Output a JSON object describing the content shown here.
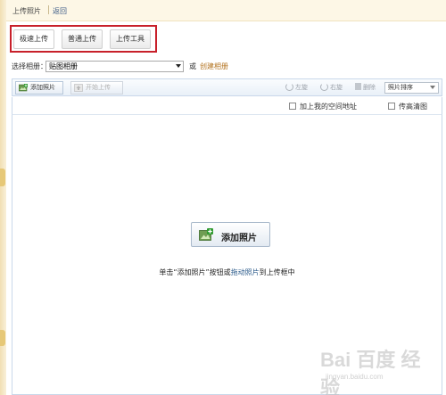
{
  "header": {
    "crumb": "上传照片",
    "back_label": "返回"
  },
  "tabs": [
    {
      "label": "极速上传",
      "active": true
    },
    {
      "label": "普通上传",
      "active": false
    },
    {
      "label": "上传工具",
      "active": false
    }
  ],
  "album": {
    "label": "选择相册：",
    "selected": "贴图相册",
    "or": "或",
    "create_label": "创建相册"
  },
  "toolbar": {
    "add_label": "添加照片",
    "start_label": "开始上传",
    "rotate_left": "左旋",
    "rotate_right": "右旋",
    "delete": "删除",
    "sort": "照片排序"
  },
  "options": {
    "add_address": "加上我的空间地址",
    "hd": "传高清图"
  },
  "drop": {
    "add_button": "添加照片",
    "hint_pre": "单击“添加照片”按钮或",
    "hint_link": "拖动照片",
    "hint_post": "到上传框中"
  },
  "watermark": {
    "brand": "Bai 百度 经验",
    "url": "jingyan.baidu.com"
  },
  "colors": {
    "highlight": "#c8202a",
    "link": "#b3731f",
    "toolbar_border": "#c9d8ea"
  }
}
